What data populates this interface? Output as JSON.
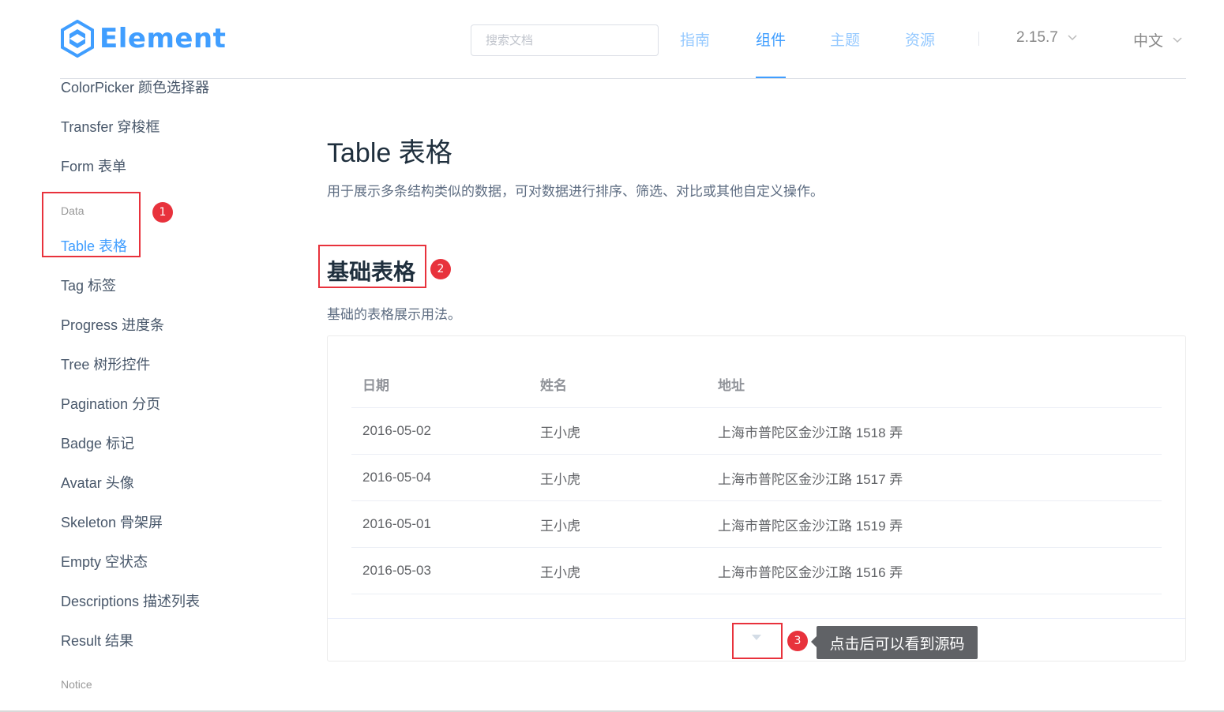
{
  "header": {
    "logo_text": "Element",
    "search_placeholder": "搜索文档",
    "nav": [
      {
        "label": "指南",
        "active": false
      },
      {
        "label": "组件",
        "active": true
      },
      {
        "label": "主题",
        "active": false
      },
      {
        "label": "资源",
        "active": false
      }
    ],
    "version": "2.15.7",
    "language": "中文"
  },
  "sidebar": {
    "items_top": [
      "ColorPicker 颜色选择器",
      "Transfer 穿梭框",
      "Form 表单"
    ],
    "group_data": "Data",
    "active_item": "Table 表格",
    "items_bottom": [
      "Tag 标签",
      "Progress 进度条",
      "Tree 树形控件",
      "Pagination 分页",
      "Badge 标记",
      "Avatar 头像",
      "Skeleton 骨架屏",
      "Empty 空状态",
      "Descriptions 描述列表",
      "Result 结果"
    ],
    "group_notice": "Notice"
  },
  "main": {
    "title": "Table 表格",
    "description": "用于展示多条结构类似的数据，可对数据进行排序、筛选、对比或其他自定义操作。",
    "section_title": "基础表格",
    "section_desc": "基础的表格展示用法。",
    "table": {
      "headers": [
        "日期",
        "姓名",
        "地址"
      ],
      "rows": [
        [
          "2016-05-02",
          "王小虎",
          "上海市普陀区金沙江路 1518 弄"
        ],
        [
          "2016-05-04",
          "王小虎",
          "上海市普陀区金沙江路 1517 弄"
        ],
        [
          "2016-05-01",
          "王小虎",
          "上海市普陀区金沙江路 1519 弄"
        ],
        [
          "2016-05-03",
          "王小虎",
          "上海市普陀区金沙江路 1516 弄"
        ]
      ]
    }
  },
  "annotations": {
    "badges": [
      "1",
      "2",
      "3"
    ],
    "tooltip": "点击后可以看到源码"
  },
  "colors": {
    "primary": "#409EFF",
    "annotation_red": "#e8323c"
  }
}
